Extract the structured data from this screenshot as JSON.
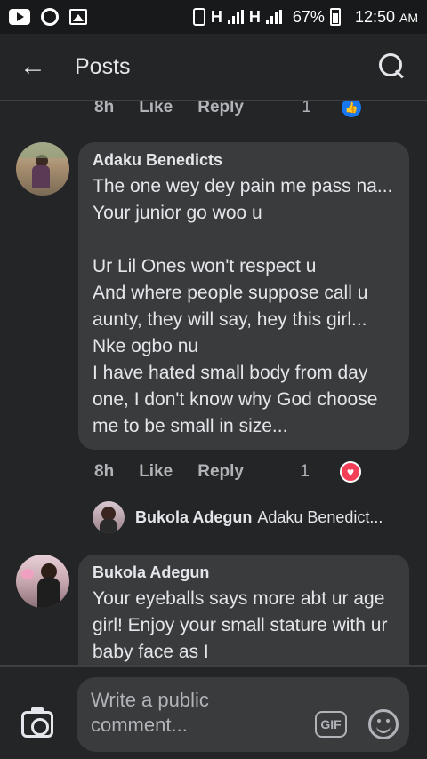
{
  "status_bar": {
    "network1": "H",
    "network2": "H",
    "battery": "67%",
    "time": "12:50",
    "ampm": "AM"
  },
  "header": {
    "title": "Posts",
    "back_icon": "arrow-left-icon",
    "search_icon": "search-icon"
  },
  "top_meta": {
    "time": "8h",
    "like": "Like",
    "reply": "Reply",
    "reactions": "1"
  },
  "comments": [
    {
      "name": "Adaku Benedicts",
      "text": "The one wey dey pain me pass na... Your junior go woo u\n\nUr Lil Ones won't respect u\nAnd where people suppose call u aunty, they will say, hey this girl... Nke ogbo nu\nI have hated small body from day one, I don't know why God choose me to be small in size...",
      "time": "8h",
      "like": "Like",
      "reply": "Reply",
      "reactions": "1"
    },
    {
      "name": "Bukola Adegun",
      "text": "Your eyeballs says more abt ur age girl! Enjoy your small stature with ur baby face as I"
    }
  ],
  "reply_preview": {
    "name": "Bukola Adegun",
    "snippet": "Adaku Benedict..."
  },
  "composer": {
    "placeholder": "Write a public comment...",
    "gif_label": "GIF"
  },
  "colors": {
    "background": "#242526",
    "bubble": "#3a3b3c",
    "like_blue": "#1877f2",
    "heart_red": "#f33e58"
  }
}
